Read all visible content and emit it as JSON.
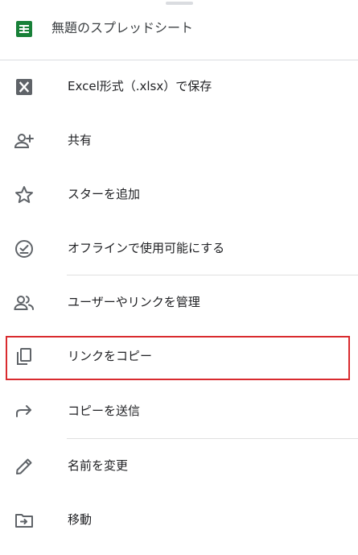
{
  "header": {
    "file_title": "無題のスプレッドシート",
    "file_icon": "google-sheets-icon",
    "file_icon_color": "#188038"
  },
  "menu": {
    "items": [
      {
        "label": "Excel形式（.xlsx）で保存",
        "icon": "excel-x-icon"
      },
      {
        "label": "共有",
        "icon": "person-add-icon"
      },
      {
        "label": "スターを追加",
        "icon": "star-outline-icon"
      },
      {
        "label": "オフラインで使用可能にする",
        "icon": "offline-check-icon"
      },
      {
        "label": "ユーザーやリンクを管理",
        "icon": "people-icon"
      },
      {
        "label": "リンクをコピー",
        "icon": "copy-icon"
      },
      {
        "label": "コピーを送信",
        "icon": "forward-arrow-icon"
      },
      {
        "label": "名前を変更",
        "icon": "pencil-icon"
      },
      {
        "label": "移動",
        "icon": "move-folder-icon"
      }
    ]
  },
  "highlight": {
    "target": "リンクをコピー",
    "color": "#d92b2f"
  },
  "colors": {
    "icon": "#5f6368",
    "divider": "#dadce0"
  }
}
